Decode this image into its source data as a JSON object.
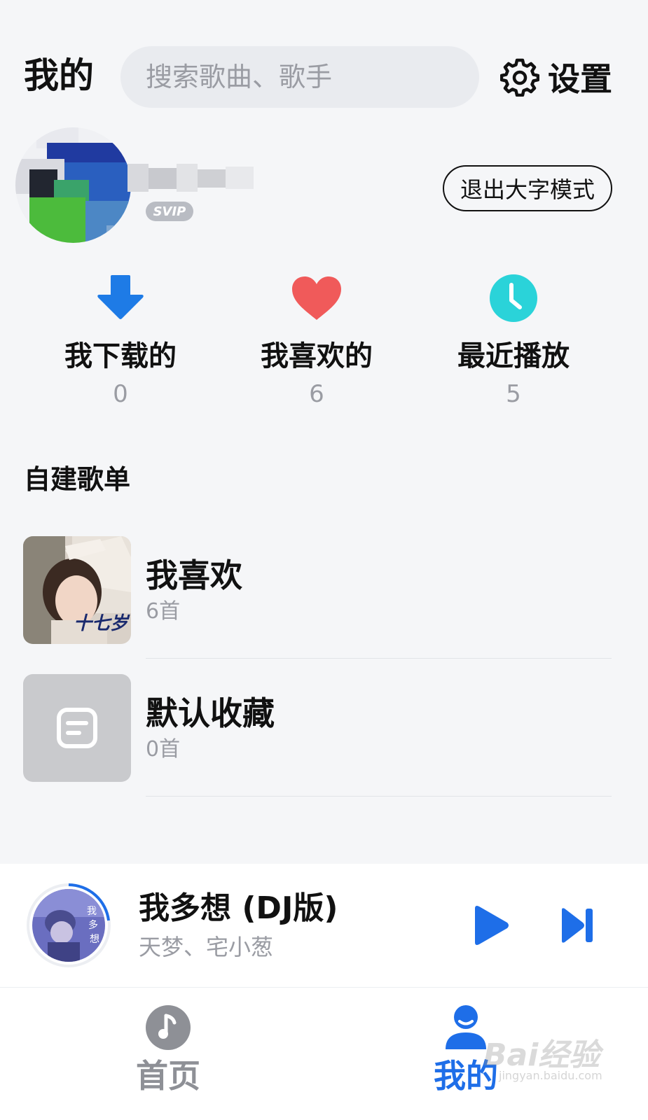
{
  "header": {
    "title": "我的",
    "search_placeholder": "搜索歌曲、歌手",
    "settings_label": "设置",
    "settings_icon": "gear-icon"
  },
  "profile": {
    "badge": "SVIP",
    "exit_large_font_label": "退出大字模式"
  },
  "stats": [
    {
      "label": "我下载的",
      "count": "0",
      "icon": "download-arrow-icon",
      "color": "#1e7be6"
    },
    {
      "label": "我喜欢的",
      "count": "6",
      "icon": "heart-icon",
      "color": "#f05a5a"
    },
    {
      "label": "最近播放",
      "count": "5",
      "icon": "clock-icon",
      "color": "#2ad3d9"
    }
  ],
  "playlists": {
    "section_title": "自建歌单",
    "items": [
      {
        "name": "我喜欢",
        "count": "6首",
        "cover_text": "十七岁"
      },
      {
        "name": "默认收藏",
        "count": "0首",
        "cover_icon": "playlist-placeholder-icon"
      }
    ]
  },
  "now_playing": {
    "title": "我多想 (DJ版)",
    "artist": "天梦、宅小葱",
    "accent": "#1e6ee8"
  },
  "tabbar": {
    "tabs": [
      {
        "label": "首页",
        "icon": "music-note-icon",
        "active": false
      },
      {
        "label": "我的",
        "icon": "person-icon",
        "active": true
      }
    ],
    "watermark": "Bai经验",
    "watermark_sub": "jingyan.baidu.com"
  }
}
